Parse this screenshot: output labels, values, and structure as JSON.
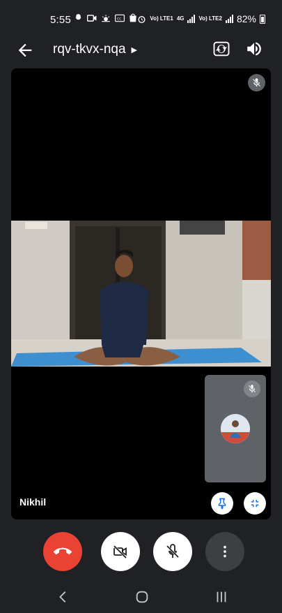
{
  "status_bar": {
    "time": "5:55",
    "left_icons": [
      "snapchat-icon",
      "video-icon",
      "weather-icon",
      "cc-icon",
      "bag-icon"
    ],
    "network_1": "Vo) LTE1",
    "network_2": "4G",
    "network_3": "Vo) LTE2",
    "battery": "82%"
  },
  "app_bar": {
    "meeting_code": "rqv-tkvx-nqa",
    "icons": [
      "back-arrow-icon",
      "switch-camera-icon",
      "speaker-icon"
    ]
  },
  "call": {
    "participant_name": "Nikhil",
    "participant_muted": true,
    "self_muted": true
  },
  "controls": {
    "buttons": [
      "end-call",
      "camera-off",
      "mic-off",
      "more-options"
    ],
    "colors": {
      "end_call": "#ea4335",
      "white": "#ffffff",
      "more": "#3c4043"
    }
  },
  "nav": {
    "icons": [
      "back-icon",
      "home-icon",
      "recents-icon"
    ]
  }
}
